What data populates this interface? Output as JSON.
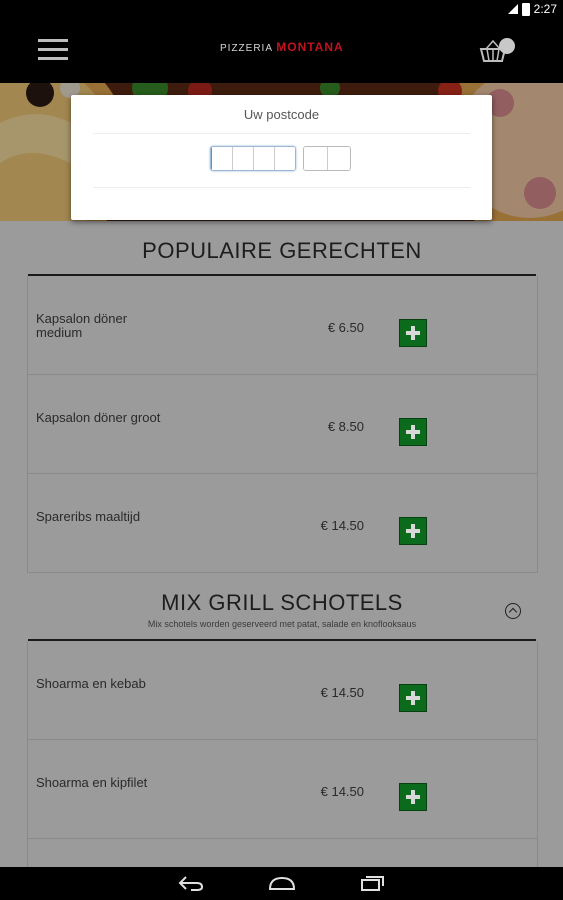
{
  "status_bar": {
    "time": "2:27"
  },
  "header": {
    "logo_prefix": "PIZZERIA",
    "logo_brand": "MONTANA"
  },
  "postcode_dialog": {
    "title": "Uw postcode"
  },
  "sections": [
    {
      "title": "POPULAIRE GERECHTEN",
      "subtitle": "",
      "items": [
        {
          "name": "Kapsalon döner medium",
          "price": "€ 6.50"
        },
        {
          "name": "Kapsalon döner groot",
          "price": "€ 8.50"
        },
        {
          "name": "Spareribs maaltijd",
          "price": "€ 14.50"
        }
      ]
    },
    {
      "title": "MIX GRILL SCHOTELS",
      "subtitle": "Mix schotels worden geserveerd met patat, salade en knoflooksaus",
      "items": [
        {
          "name": "Shoarma en kebab",
          "price": "€ 14.50"
        },
        {
          "name": "Shoarma en kipfilet",
          "price": "€ 14.50"
        }
      ]
    }
  ],
  "colors": {
    "brand": "#c1121f",
    "add_button": "#0c6a1c",
    "overlay_background": "#9b9b9b",
    "app_bar": "#000000"
  },
  "icons": {
    "menu": "hamburger-icon",
    "cart": "basket-icon",
    "add": "plus-icon",
    "collapse": "chevron-up-circle-icon",
    "back": "back-icon",
    "home": "home-icon",
    "recents": "recents-icon"
  }
}
